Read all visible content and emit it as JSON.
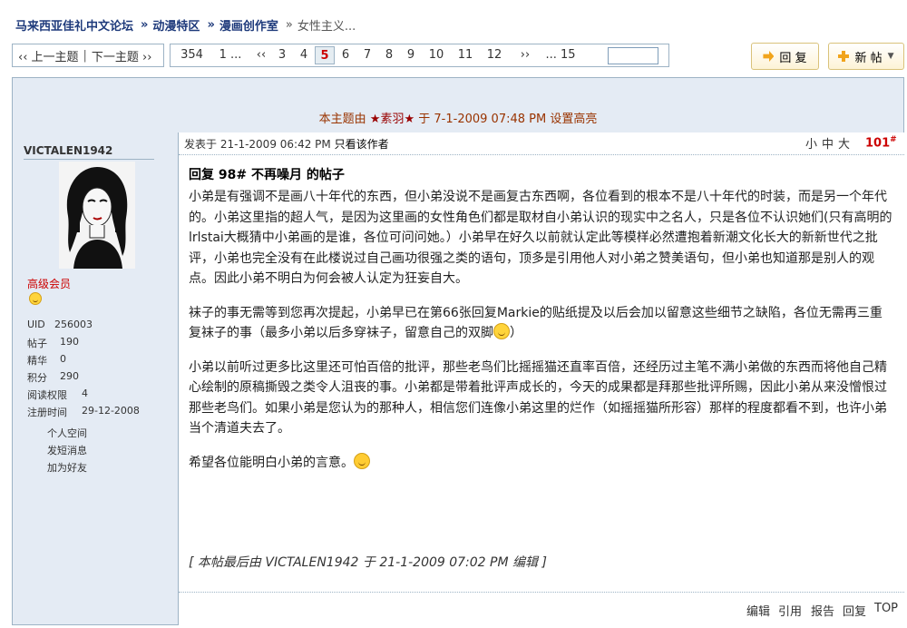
{
  "breadcrumb": {
    "site": "马来西亚佳礼中文论坛",
    "section": "动漫特区",
    "subsection": "漫画创作室",
    "current": "女性主义..."
  },
  "thread_nav": {
    "prev": "‹‹ 上一主题",
    "next": "下一主题 ››"
  },
  "pager": {
    "total": "354",
    "first": "1 ...",
    "prev": "‹‹",
    "pages": [
      "3",
      "4",
      "5",
      "6",
      "7",
      "8",
      "9",
      "10",
      "11",
      "12"
    ],
    "current_page": "5",
    "next": "››",
    "last": "... 15"
  },
  "buttons": {
    "reply": "回 复",
    "new_post": "新 帖"
  },
  "highlight_note": {
    "prefix": "本主题由",
    "user": "★素羽★",
    "mid": "于",
    "date": "7-1-2009 07:48 PM",
    "suffix": "设置高亮"
  },
  "author": {
    "name": "VICTALEN1942",
    "rank": "高级会员",
    "stats": [
      {
        "label": "UID",
        "value": "256003"
      },
      {
        "label": "帖子",
        "value": "190"
      },
      {
        "label": "精华",
        "value": "0"
      },
      {
        "label": "积分",
        "value": "290"
      },
      {
        "label": "阅读权限",
        "value": "4"
      },
      {
        "label": "注册时间",
        "value": "29-12-2008"
      }
    ],
    "links": [
      "个人空间",
      "发短消息",
      "加为好友"
    ]
  },
  "post": {
    "posted_label": "发表于",
    "posted_date": "21-1-2009 06:42 PM",
    "only_author": "只看该作者",
    "font_sizes": "小中大",
    "floor": "101",
    "floor_mark": "#",
    "title": "回复  98# 不再噪月  的帖子",
    "paragraphs": [
      "小弟是有强调不是画八十年代的东西，但小弟没说不是画复古东西啊，各位看到的根本不是八十年代的时装，而是另一个年代的。小弟这里指的超人气，是因为这里画的女性角色们都是取材自小弟认识的现实中之名人，只是各位不认识她们(只有高明的lrlstai大概猜中小弟画的是谁，各位可问问她。）小弟早在好久以前就认定此等模样必然遭抱着新潮文化长大的新新世代之批评，小弟也完全没有在此楼说过自己画功很强之类的语句，顶多是引用他人对小弟之赞美语句，但小弟也知道那是别人的观点。因此小弟不明白为何会被人认定为狂妄自大。",
      "袜子的事无需等到您再次提起，小弟早已在第66张回复Markie的贴纸提及以后会加以留意这些细节之缺陷，各位无需再三重复袜子的事（最多小弟以后多穿袜子，留意自己的双脚",
      "小弟以前听过更多比这里还可怕百倍的批评，那些老鸟们比摇摇猫还直率百倍，还经历过主笔不满小弟做的东西而将他自己精心绘制的原稿撕毁之类令人沮丧的事。小弟都是带着批评声成长的，今天的成果都是拜那些批评所赐，因此小弟从来没憎恨过那些老鸟们。如果小弟是您认为的那种人，相信您们连像小弟这里的烂作（如摇摇猫所形容）那样的程度都看不到，也许小弟当个清道夫去了。",
      "希望各位能明白小弟的言意。"
    ],
    "p2_tail": "）",
    "edit_note": "[ 本帖最后由  VICTALEN1942  于  21-1-2009 07:02 PM  编辑  ]",
    "actions": [
      "编辑",
      "引用",
      "报告",
      "回复",
      "TOP"
    ]
  },
  "colors": {
    "link_blue": "#1e3a7b",
    "highlight_red": "#993300",
    "border": "#9db3c5",
    "panel": "#e4ebf4"
  }
}
